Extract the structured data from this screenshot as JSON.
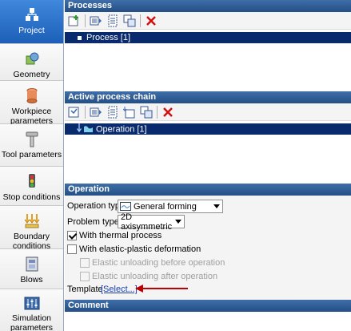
{
  "sidebar": {
    "items": [
      {
        "label": "Project",
        "icon": "project-icon"
      },
      {
        "label": "Geometry",
        "icon": "geometry-icon"
      },
      {
        "label": "Workpiece parameters",
        "icon": "workpiece-icon"
      },
      {
        "label": "Tool parameters",
        "icon": "tool-icon"
      },
      {
        "label": "Stop conditions",
        "icon": "stop-conditions-icon"
      },
      {
        "label": "Boundary conditions",
        "icon": "boundary-conditions-icon"
      },
      {
        "label": "Blows",
        "icon": "blows-icon"
      },
      {
        "label": "Simulation parameters",
        "icon": "simulation-parameters-icon"
      }
    ],
    "active_color": "#2b6fc6"
  },
  "processes": {
    "header": "Processes",
    "selected_item": "Process [1]"
  },
  "chain": {
    "header": "Active process chain",
    "selected_item": "Operation [1]"
  },
  "operation": {
    "header": "Operation",
    "operation_type_label": "Operation type",
    "operation_type_value": "General forming",
    "problem_type_label": "Problem type",
    "problem_type_value": "2D axisymmetric",
    "thermal_label": "With thermal process",
    "thermal_checked": true,
    "elastic_label": "With elastic-plastic deformation",
    "elastic_checked": false,
    "unload_before_label": "Elastic unloading before operation",
    "unload_after_label": "Elastic unloading after operation",
    "template_label": "Template",
    "template_link": "[Select...]"
  },
  "comment": {
    "header": "Comment"
  },
  "colors": {
    "header_bg": "#2e5c97",
    "selection_bg": "#0a2a6e",
    "arrow": "#c00000"
  }
}
